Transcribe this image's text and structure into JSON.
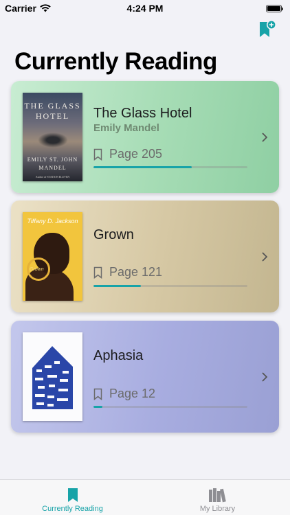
{
  "status_bar": {
    "carrier": "Carrier",
    "time": "4:24 PM"
  },
  "header": {
    "title": "Currently Reading",
    "add_icon": "bookmark-plus-icon"
  },
  "accent_color": "#17a3a8",
  "books": [
    {
      "title": "The Glass Hotel",
      "author": "Emily Mandel",
      "page_label": "Page 205",
      "progress": 0.64,
      "cover": {
        "title": "THE GLASS HOTEL",
        "author": "EMILY ST. JOHN MANDEL",
        "tagline": "Author of STATION ELEVEN"
      }
    },
    {
      "title": "Grown",
      "author": "",
      "page_label": "Page 121",
      "progress": 0.31,
      "cover": {
        "title": "Tiffany D. Jackson",
        "tagline": "Grown"
      }
    },
    {
      "title": "Aphasia",
      "author": "",
      "page_label": "Page 12",
      "progress": 0.06,
      "cover": {}
    }
  ],
  "tabs": [
    {
      "label": "Currently Reading",
      "icon": "bookmark-icon",
      "active": true
    },
    {
      "label": "My Library",
      "icon": "library-books-icon",
      "active": false
    }
  ]
}
